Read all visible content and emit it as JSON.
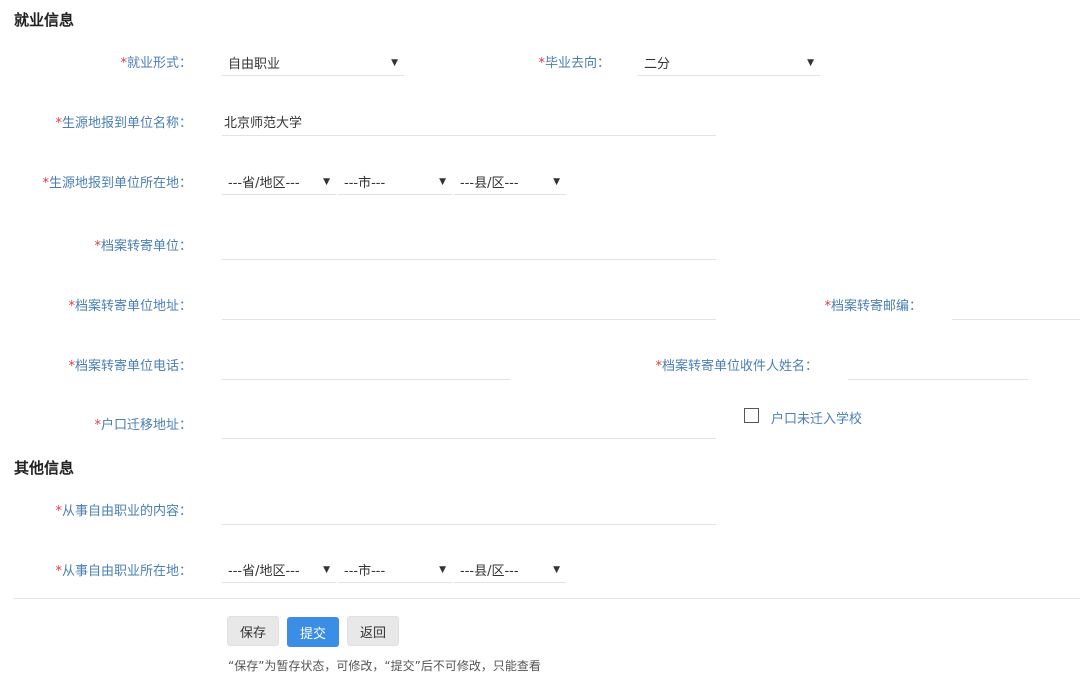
{
  "employment_section": {
    "title": "就业信息",
    "employment_form": {
      "label": "就业形式：",
      "value": "自由职业"
    },
    "graduation_destination": {
      "label": "毕业去向：",
      "value": "二分"
    },
    "report_unit_name": {
      "label": "生源地报到单位名称：",
      "value": "北京师范大学"
    },
    "report_unit_location": {
      "label": "生源地报到单位所在地：",
      "province": "---省/地区---",
      "city": "---市---",
      "county": "---县/区---"
    },
    "archive_unit": {
      "label": "档案转寄单位：",
      "value": ""
    },
    "archive_unit_address": {
      "label": "档案转寄单位地址：",
      "value": ""
    },
    "archive_postcode": {
      "label": "档案转寄邮编：",
      "value": ""
    },
    "archive_unit_phone": {
      "label": "档案转寄单位电话：",
      "value": ""
    },
    "archive_recipient_name": {
      "label": "档案转寄单位收件人姓名：",
      "value": ""
    },
    "hukou_address": {
      "label": "户口迁移地址：",
      "value": ""
    },
    "hukou_not_moved": {
      "label": "户口未迁入学校",
      "checked": false
    }
  },
  "other_section": {
    "title": "其他信息",
    "freelance_content": {
      "label": "从事自由职业的内容：",
      "value": ""
    },
    "freelance_location": {
      "label": "从事自由职业所在地：",
      "province": "---省/地区---",
      "city": "---市---",
      "county": "---县/区---"
    }
  },
  "required_mark": "*",
  "caret_glyph": "▼",
  "buttons": {
    "save": "保存",
    "submit": "提交",
    "back": "返回"
  },
  "footer_note": "“保存”为暂存状态，可修改，“提交”后不可修改，只能查看"
}
